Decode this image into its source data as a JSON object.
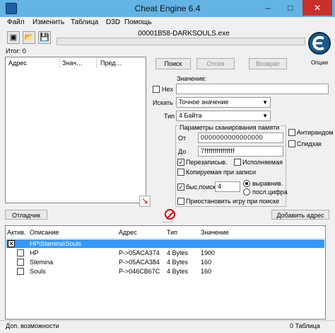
{
  "window": {
    "title": "Cheat Engine 6.4",
    "minimize": "‒",
    "maximize": "□",
    "close": "✕"
  },
  "menu": [
    "Файл",
    "Изменить",
    "Таблица",
    "D3D",
    "Помощь"
  ],
  "toolbar": {
    "process_name": "00001B58-DARKSOULS.exe"
  },
  "found": "Итог: 0",
  "results_columns": [
    "Адрес",
    "Знач…",
    "Пред…"
  ],
  "scan_buttons": {
    "first": "Поиск",
    "next": "Отсев",
    "undo": "Возврат"
  },
  "logo": {
    "caption": "Опции"
  },
  "value": {
    "label": "Значение:",
    "hex_label": "Hex",
    "input": ""
  },
  "scan_type": {
    "label": "Искать",
    "selected": "Точное значение"
  },
  "value_type": {
    "label": "Тип",
    "selected": "4 Байта"
  },
  "memory_options": {
    "title": "Параметры сканирования памяти",
    "from_label": "От",
    "from_value": "0000000000000000",
    "to_label": "До",
    "to_value": "7fffffffffffffff",
    "writable": "Перезаписыв.",
    "executable": "Исполняемая",
    "copy_on_write": "Копируемая при записи",
    "fast_scan": "быс.поиск",
    "fast_scan_value": "4",
    "alignment": "выравнив.",
    "last_digits": "посл.цифра",
    "pause": "Приостановить игру при поиске"
  },
  "extra_options": {
    "random": "Антирандом",
    "speedhack": "Спидхак"
  },
  "bottom_buttons": {
    "debugger": "Отладчик",
    "add_address": "Добавить адрес"
  },
  "table": {
    "columns": [
      "Актив.",
      "Описание",
      "Адрес",
      "Тип",
      "Значение"
    ],
    "group": {
      "description": "HP\\Stamina\\Souls"
    },
    "rows": [
      {
        "description": "HP",
        "address": "P->05ACA374",
        "type": "4 Bytes",
        "value": "1900"
      },
      {
        "description": "Stemina",
        "address": "P->05ACA384",
        "type": "4 Bytes",
        "value": "160"
      },
      {
        "description": "Souls",
        "address": "P->046CB67C",
        "type": "4 Bytes",
        "value": "160"
      }
    ]
  },
  "status": {
    "left": "Доп. возможности",
    "right": "0 Таблица"
  },
  "colors": {
    "titlebar": "#63b3e5",
    "selection": "#3399ff",
    "close": "#c7302b"
  }
}
